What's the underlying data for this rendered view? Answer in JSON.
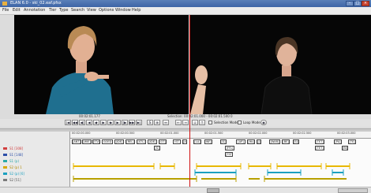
{
  "window": {
    "title": "ELAN 6.0 - ski_02.eaf.pfsx"
  },
  "menu": [
    "File",
    "Edit",
    "Annotation",
    "Tier",
    "Type",
    "Search",
    "View",
    "Options",
    "Window",
    "Help"
  ],
  "media": {
    "current_time": "00:02:01.177",
    "selection": "Selection: 00:02:01.000 - 00:02:01.500  0"
  },
  "controls": {
    "buttons": [
      "|◀",
      "◀◀",
      "◀|",
      "◀",
      "◀·",
      "▶",
      "·▶",
      "▶",
      "|▶",
      "▶▶",
      "▶|"
    ],
    "extra_buttons": [
      "S",
      "⊕",
      "↔",
      "←",
      "→",
      "↓",
      "↑"
    ],
    "selection_mode_label": "Selection Mode",
    "loop_mode_label": "Loop Mode"
  },
  "tiers": [
    {
      "name": "S1 [308]",
      "color": "#d24040"
    },
    {
      "name": "S1 [148]",
      "color": "#2c4fa8"
    },
    {
      "name": "S1 (p)",
      "color": "#2aa9a9"
    },
    {
      "name": "S2 (p) 1",
      "color": "#d8a800"
    },
    {
      "name": "S2 (p) [6]",
      "color": "#1aa0c0"
    },
    {
      "name": "S1 [0]",
      "color": "#d0a000"
    },
    {
      "name": "S2 [51]",
      "color": "#7a7a7a"
    }
  ],
  "ruler_ticks": [
    "00:02:00.000",
    "00:02:00.500",
    "00:02:01.000",
    "00:02:01.500",
    "00:02:02.000",
    "00:02:02.500",
    "00:02:03.000"
  ],
  "annotations_row1": [
    "[ANT]",
    "[WIE]",
    "[ITV]",
    "GOED",
    "[IDE]",
    "[REL]",
    "[STL]",
    "[IDE]",
    "[OT]",
    "IST",
    "[A]",
    "[LA]",
    "INF]",
    "[S]",
    "[AP]",
    "[Hb]",
    "[J]",
    "[WAR]",
    "[BE]",
    "[Sl]",
    "[TET]",
    "[PA]",
    "[TE]"
  ],
  "annotations_row2": [
    "[S]",
    "[FFL]",
    "[TST]",
    "[TET]",
    "[BI]"
  ]
}
